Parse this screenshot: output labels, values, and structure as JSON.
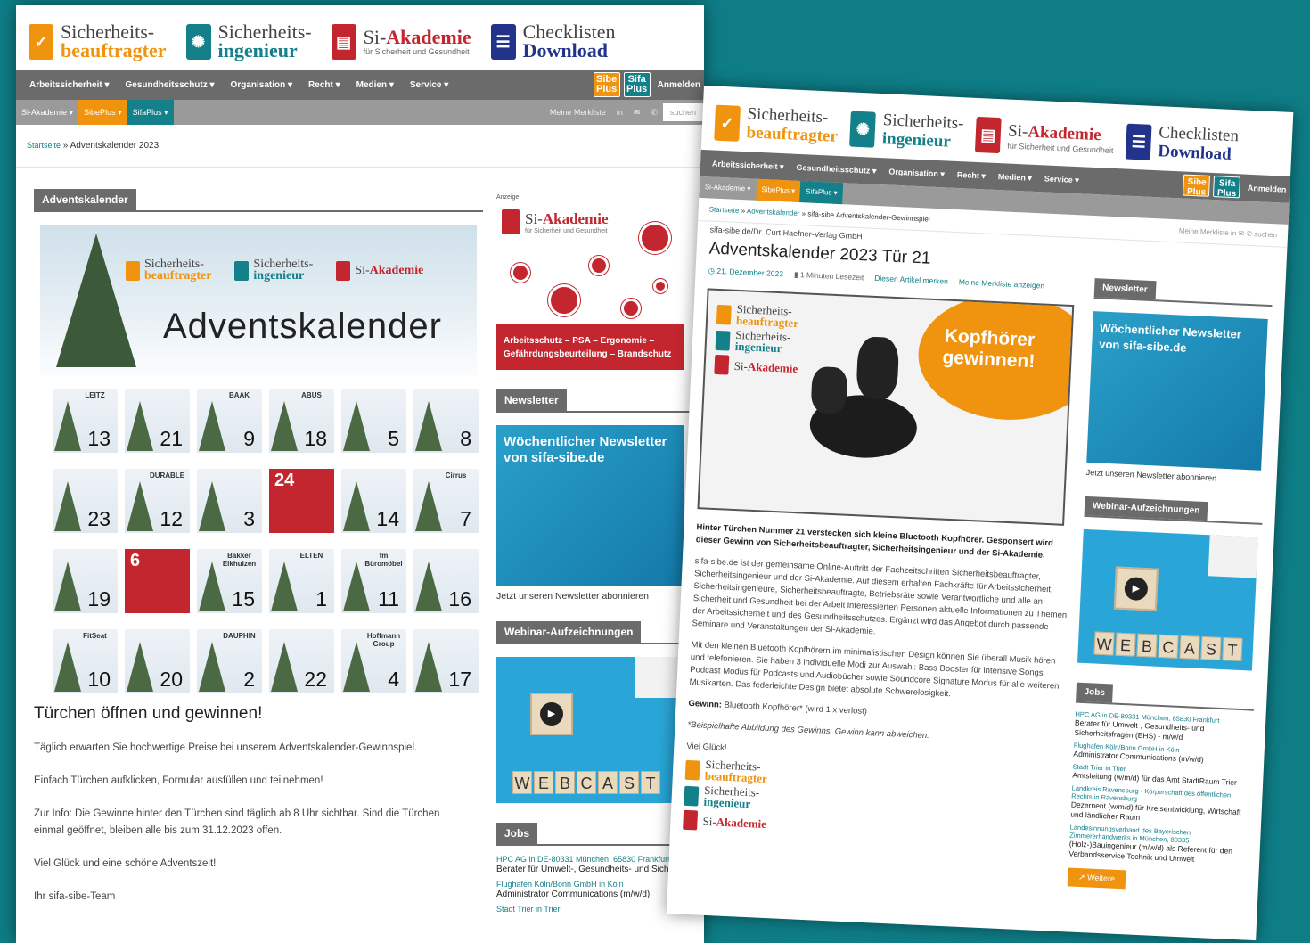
{
  "brands": [
    {
      "line1": "Sicherheits-",
      "line2": "beauftragter",
      "sub": "",
      "color": "#f0940f"
    },
    {
      "line1": "Sicherheits-",
      "line2": "ingenieur",
      "sub": "",
      "color": "#14808a"
    },
    {
      "line1": "Si-",
      "line2": "Akademie",
      "sub": "für Sicherheit und Gesundheit",
      "color": "#c3262f"
    },
    {
      "line1": "Checklisten",
      "line2": "Download",
      "sub": "",
      "color": "#22338b"
    }
  ],
  "mainnav": {
    "items": [
      "Arbeitssicherheit ▾",
      "Gesundheitsschutz ▾",
      "Organisation ▾",
      "Recht ▾",
      "Medien ▾",
      "Service ▾"
    ],
    "sibe_plus": "Sibe Plus",
    "sifa_plus": "Sifa Plus",
    "login": "Anmelden"
  },
  "subnav": {
    "items": [
      "Si-Akademie ▾",
      "SibePlus ▾",
      "SifaPlus ▾"
    ],
    "merkliste": "Meine Merkliste",
    "search_placeholder": "suchen"
  },
  "page1": {
    "breadcrumb_home": "Startseite",
    "breadcrumb_sep": " » ",
    "breadcrumb_current": "Adventskalender 2023",
    "section_title": "Adventskalender",
    "hero_title": "Adventskalender",
    "doors": [
      {
        "label": "LEITZ",
        "num": "13"
      },
      {
        "label": "",
        "num": "21"
      },
      {
        "label": "BAAK",
        "num": "9"
      },
      {
        "label": "ABUS",
        "num": "18"
      },
      {
        "label": "",
        "num": "5"
      },
      {
        "label": "",
        "num": "8"
      },
      {
        "label": "",
        "num": "23"
      },
      {
        "label": "DURABLE",
        "num": "12"
      },
      {
        "label": "",
        "num": "3"
      },
      {
        "label": "",
        "num": "24",
        "santa": true
      },
      {
        "label": "",
        "num": "14"
      },
      {
        "label": "Cirrus",
        "num": "7"
      },
      {
        "label": "",
        "num": "19"
      },
      {
        "label": "",
        "num": "6",
        "santa": true
      },
      {
        "label": "Bakker Elkhuizen",
        "num": "15"
      },
      {
        "label": "ELTEN",
        "num": "1"
      },
      {
        "label": "fm Büromöbel",
        "num": "11"
      },
      {
        "label": "",
        "num": "16"
      },
      {
        "label": "FitSeat",
        "num": "10"
      },
      {
        "label": "",
        "num": "20"
      },
      {
        "label": "DAUPHIN",
        "num": "2"
      },
      {
        "label": "",
        "num": "22"
      },
      {
        "label": "Hoffmann Group",
        "num": "4"
      },
      {
        "label": "",
        "num": "17"
      }
    ],
    "cta": "Türchen öffnen und gewinnen!",
    "paragraphs": [
      "Täglich erwarten Sie hochwertige Preise bei unserem Adventskalender-Gewinnspiel.",
      "Einfach Türchen aufklicken, Formular ausfüllen und teilnehmen!",
      "Zur Info: Die Gewinne hinter den Türchen sind täglich ab 8 Uhr sichtbar. Sind die Türchen einmal geöffnet, bleiben alle bis zum 31.12.2023 offen.",
      "Viel Glück und eine schöne Adventszeit!",
      "Ihr sifa-sibe-Team"
    ]
  },
  "sidebar": {
    "ad_label": "Anzeige",
    "ad_brand1": "Si-",
    "ad_brand2": "Akademie",
    "ad_sub": "für Sicherheit und Gesundheit",
    "ad_band": "Arbeitsschutz – PSA – Ergonomie – Gefährdungsbeurteilung – Brandschutz",
    "newsletter_head": "Newsletter",
    "newsletter_box": "Wöchentlicher Newsletter von sifa-sibe.de",
    "newsletter_link": "Jetzt unseren Newsletter abonnieren",
    "webinar_head": "Webinar-Aufzeichnungen",
    "webcast_letters": [
      "W",
      "E",
      "B",
      "C",
      "A",
      "S",
      "T"
    ],
    "jobs_head": "Jobs",
    "jobs": [
      {
        "company": "HPC AG in DE-80331 München, 65830 Frankfurt",
        "title": "Berater für Umwelt-, Gesundheits- und Sicherheitsfragen (EHS) - m/w/d"
      },
      {
        "company": "Flughafen Köln/Bonn GmbH in Köln",
        "title": "Administrator Communications (m/w/d)"
      },
      {
        "company": "Stadt Trier in Trier",
        "title": "Amtsleitung (w/m/d) für das Amt StadtRaum Trier"
      },
      {
        "company": "Landkreis Ravensburg - Körperschaft des öffentlichen Rechts in Ravensburg",
        "title": "Dezernent (w/m/d) für Kreisentwicklung, Wirtschaft und ländlicher Raum"
      },
      {
        "company": "Landesinnungsverband des Bayerischen Zimmererhandwerks in München, 80335",
        "title": "(Holz-)Bauingenieur (m/w/d) als Referent für den Verbandsservice Technik und Umwelt"
      }
    ],
    "more_button": "Weitere"
  },
  "page2": {
    "breadcrumb_home": "Startseite",
    "breadcrumb_mid": "Adventskalender",
    "breadcrumb_current": "sifa-sibe Adventskalender-Gewinnspiel",
    "author": "sifa-sibe.de/Dr. Curt Haefner-Verlag GmbH",
    "title": "Adventskalender 2023 Tür 21",
    "date": "21. Dezember 2023",
    "readtime": "1 Minuten Lesezeit",
    "bookmark": "Diesen Artikel merken",
    "show_list": "Meine Merkliste anzeigen",
    "prize_text": "Kopfhörer gewinnen!",
    "intro": "Hinter Türchen Nummer 21 verstecken sich kleine Bluetooth Kopfhörer. Gesponsert wird dieser Gewinn von Sicherheitsbeauftragter, Sicherheitsingenieur und der Si-Akademie.",
    "body1": "sifa-sibe.de ist der gemeinsame Online-Auftritt der Fachzeitschriften Sicherheitsbeauftragter, Sicherheitsingenieur und der Si-Akademie. Auf diesem erhalten Fachkräfte für Arbeitssicherheit, Sicherheitsingenieure, Sicherheitsbeauftragte, Betriebsräte sowie Verantwortliche und alle an Sicherheit und Gesundheit bei der Arbeit interessierten Personen aktuelle Informationen zu Themen der Arbeitssicherheit und des Gesundheitsschutzes. Ergänzt wird das Angebot durch passende Seminare und Veranstaltungen der Si-Akademie.",
    "body2": "Mit den kleinen Bluetooth Kopfhörern im minimalistischen Design können Sie überall Musik hören und telefonieren. Sie haben 3 individuelle Modi zur Auswahl: Bass Booster für intensive Songs, Podcast Modus für Podcasts und Audiobücher sowie Soundcore Signature Modus für alle weiteren Musikarten. Das federleichte Design bietet absolute Schwerelosigkeit.",
    "win_label": "Gewinn:",
    "win_value": " Bluetooth Kopfhörer* (wird 1 x verlost)",
    "note": "*Beispielhafte Abbildung des Gewinns. Gewinn kann abweichen.",
    "closing": "Viel Glück!"
  }
}
